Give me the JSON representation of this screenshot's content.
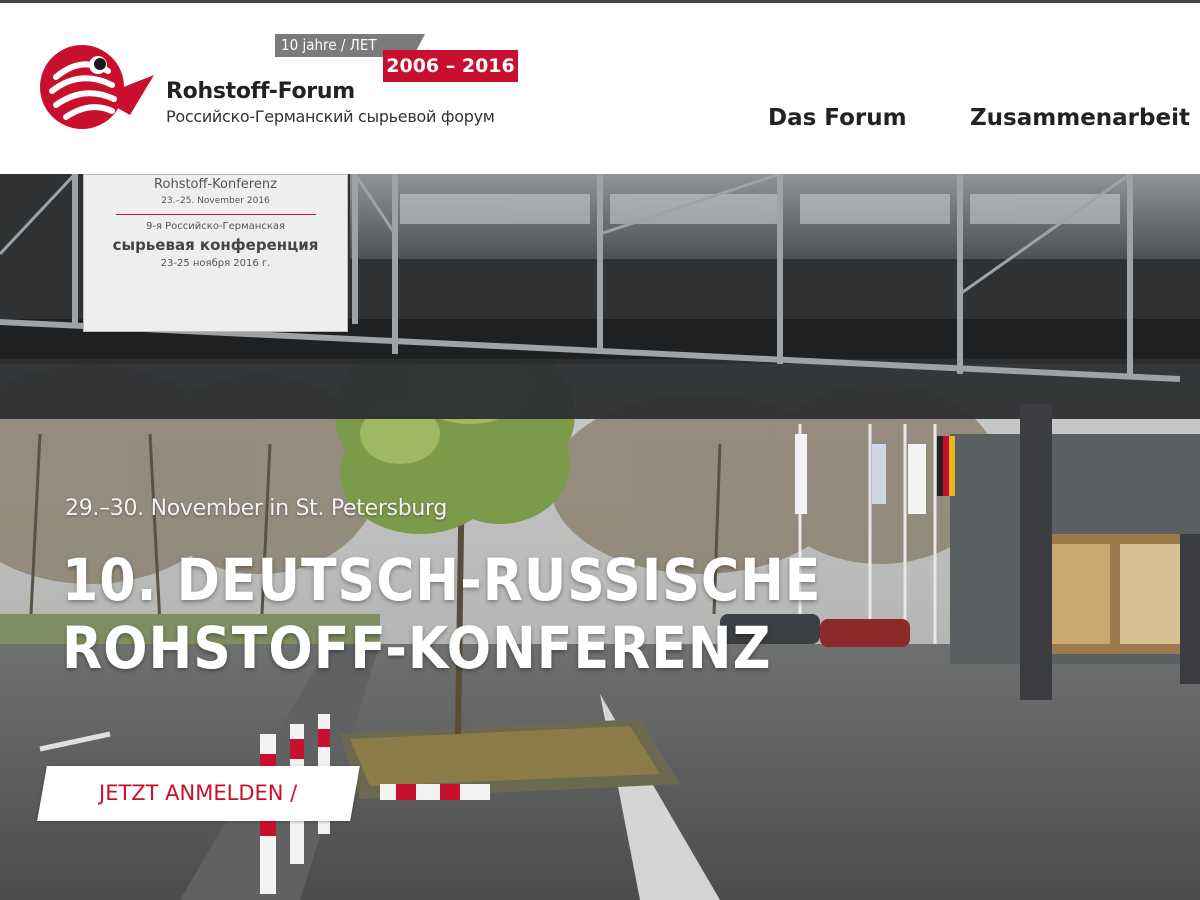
{
  "header": {
    "badge_years": "10 jahre / ЛЕТ",
    "badge_dates": "2006 – 2016",
    "brand_name": "Rohstoff-Forum",
    "brand_subtitle": "Российско-Германский сырьевой форум",
    "logo_icon": "rohstoff-forum-logo",
    "nav": [
      {
        "label": "Das Forum"
      },
      {
        "label": "Zusammenarbeit"
      }
    ]
  },
  "hero": {
    "background": "photo of a covered walkway bridge over a road with trees and flags",
    "banner": {
      "line1": "Rohstoff-Konferenz",
      "line2": "23.–25. November 2016",
      "line3": "9-я Российско-Германская",
      "line4": "сырьевая конференция",
      "line5": "23-25 ноября 2016 г."
    },
    "date": "29.–30. November in St. Petersburg",
    "title_line1": "10. DEUTSCH-RUSSISCHE",
    "title_line2": "ROHSTOFF-KONFERENZ",
    "cta_label": "JETZT ANMELDEN /"
  },
  "colors": {
    "accent": "#c8102e",
    "badge_gray": "#7b7b7b",
    "text_dark": "#222222"
  }
}
